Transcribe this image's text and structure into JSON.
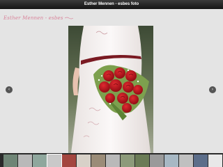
{
  "window": {
    "title": "Esther Mennen - esbes foto"
  },
  "brand": {
    "logo_text": "Esther Mennen - esbes"
  },
  "navigation": {
    "prev_icon": "chevron-left-icon",
    "next_icon": "chevron-right-icon",
    "prev_glyph": "‹",
    "next_glyph": "›"
  },
  "filmstrip": {
    "thumbnails": [
      {
        "color": "#6f8576"
      },
      {
        "color": "#b9b9b9"
      },
      {
        "color": "#8fa79d"
      },
      {
        "color": "#c9c9c9"
      },
      {
        "color": "#a3463f"
      },
      {
        "color": "#d8d1c8"
      },
      {
        "color": "#9b8c78"
      },
      {
        "color": "#b9b9b9"
      },
      {
        "color": "#8d9a7a"
      },
      {
        "color": "#6b7b56"
      },
      {
        "color": "#9a9a9a"
      },
      {
        "color": "#a7b8c4"
      },
      {
        "color": "#c0c0c0"
      },
      {
        "color": "#5c6e8a"
      },
      {
        "color": "#e8e8e8"
      },
      {
        "color": "#7e8f6d"
      },
      {
        "color": "#a5a5a5"
      },
      {
        "color": "#5b6f85"
      },
      {
        "color": "#8b9d7a"
      },
      {
        "color": "#b0b0b0"
      }
    ]
  },
  "colors": {
    "titlebar": "#1e1e1e",
    "background": "#e4e4e4",
    "logo": "#d9839a",
    "bouquet_red": "#c2151c",
    "sash": "#7a1a22"
  }
}
